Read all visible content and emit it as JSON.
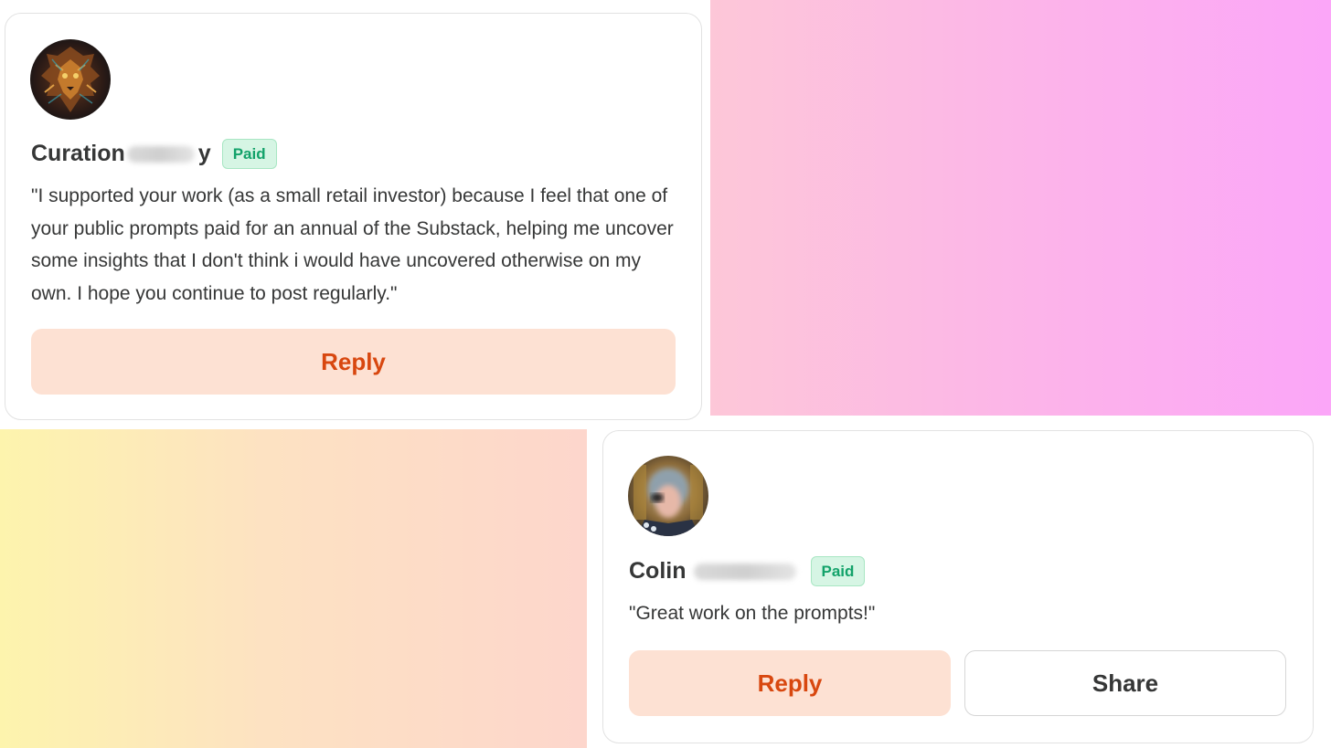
{
  "comments": [
    {
      "author_visible": "Curation",
      "author_tail": "y",
      "badge": "Paid",
      "text": "\"I supported your work (as a small retail investor) because I feel that one of your public prompts paid for an annual of the Substack, helping me uncover some insights that I don't think i would have uncovered otherwise on my own. I hope you continue to post regularly.\"",
      "actions": {
        "reply": "Reply"
      }
    },
    {
      "author_visible": "Colin",
      "badge": "Paid",
      "text": "\"Great work on the prompts!\"",
      "actions": {
        "reply": "Reply",
        "share": "Share"
      }
    }
  ],
  "colors": {
    "reply_bg": "#fde1d3",
    "reply_text": "#d8470f",
    "badge_bg": "#d6f5e4",
    "badge_text": "#13a26a"
  }
}
